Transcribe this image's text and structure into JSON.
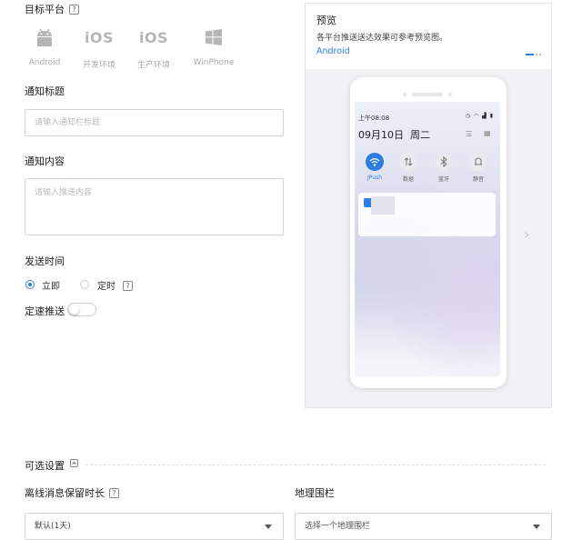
{
  "target_platform": {
    "label": "目标平台",
    "help": "?",
    "platforms": [
      {
        "icon": "android-icon",
        "label": "Android"
      },
      {
        "icon": "ios-icon",
        "text": "iOS",
        "label": "开发环境"
      },
      {
        "icon": "ios-icon",
        "text": "iOS",
        "label": "生产环境"
      },
      {
        "icon": "windows-icon",
        "label": "WinPhone"
      }
    ]
  },
  "notification_title": {
    "label": "通知标题",
    "placeholder": "请输入通知栏标题"
  },
  "notification_content": {
    "label": "通知内容",
    "placeholder": "请输入推送内容"
  },
  "send_time": {
    "label": "发送时间",
    "options": [
      {
        "label": "立即",
        "selected": true
      },
      {
        "label": "定时",
        "selected": false,
        "help": "?"
      }
    ]
  },
  "rate_push": {
    "label": "定速推送",
    "enabled": false
  },
  "preview": {
    "title": "预览",
    "description": "各平台推送送达效果可参考预览图。",
    "tab": "Android",
    "phone": {
      "status_time": "上午08:08",
      "date": "09月10日",
      "weekday": "周二",
      "quick_settings": [
        {
          "icon": "wifi-icon",
          "label": "JPush",
          "active": true
        },
        {
          "icon": "data-icon",
          "label": "数据",
          "active": false
        },
        {
          "icon": "bluetooth-icon",
          "label": "蓝牙",
          "active": false
        },
        {
          "icon": "bell-icon",
          "label": "静音",
          "active": false
        }
      ]
    }
  },
  "optional_settings": {
    "label": "可选设置",
    "offline_retention": {
      "label": "离线消息保留时长",
      "help": "?",
      "value": "默认(1天)"
    },
    "geofence": {
      "label": "地理围栏",
      "placeholder": "选择一个地理围栏"
    }
  },
  "colors": {
    "accent": "#2f7de1",
    "border": "#d4d4d4"
  }
}
